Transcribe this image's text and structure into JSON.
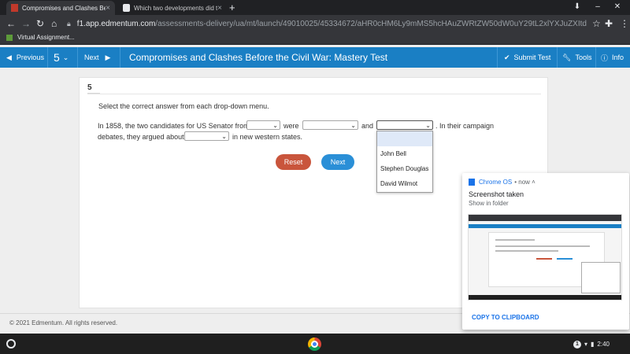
{
  "browser": {
    "tabs": [
      {
        "title": "Compromises and Clashes Befo",
        "active": true
      },
      {
        "title": "Which two developments did the",
        "active": false
      }
    ],
    "new_tab": "+",
    "url_host": "f1.app.edmentum.com",
    "url_path": "/assessments-delivery/ua/mt/launch/49010025/45334672/aHR0cHM6Ly9mMS5hcHAuZWRtZW50dW0uY29tL2xlYXJuZXItdWkvc2Nlc3NpbmNpZ25...",
    "bookmark": "Virtual Assignment..."
  },
  "appbar": {
    "previous": "Previous",
    "question_number": "5",
    "next": "Next",
    "title": "Compromises and Clashes Before the Civil War: Mastery Test",
    "submit": "Submit Test",
    "tools": "Tools",
    "info": "Info"
  },
  "question": {
    "number": "5",
    "instruction": "Select the correct answer from each drop-down menu.",
    "text_1": "In 1858, the two candidates for US Senator from",
    "text_2": "were",
    "text_3": "and",
    "text_4": ". In their campaign",
    "text_5": "debates, they argued about",
    "text_6": "in new western states.",
    "dropdown_options": [
      "",
      "John Bell",
      "Stephen Douglas",
      "David Wilmot"
    ],
    "reset": "Reset",
    "next": "Next"
  },
  "footer": {
    "copyright": "© 2021 Edmentum. All rights reserved."
  },
  "notification": {
    "source": "Chrome OS",
    "when": "• now ˄",
    "heading": "Screenshot taken",
    "sub": "Show in folder",
    "action": "COPY TO CLIPBOARD"
  },
  "shelf": {
    "badge": "1",
    "time": "2:40"
  }
}
